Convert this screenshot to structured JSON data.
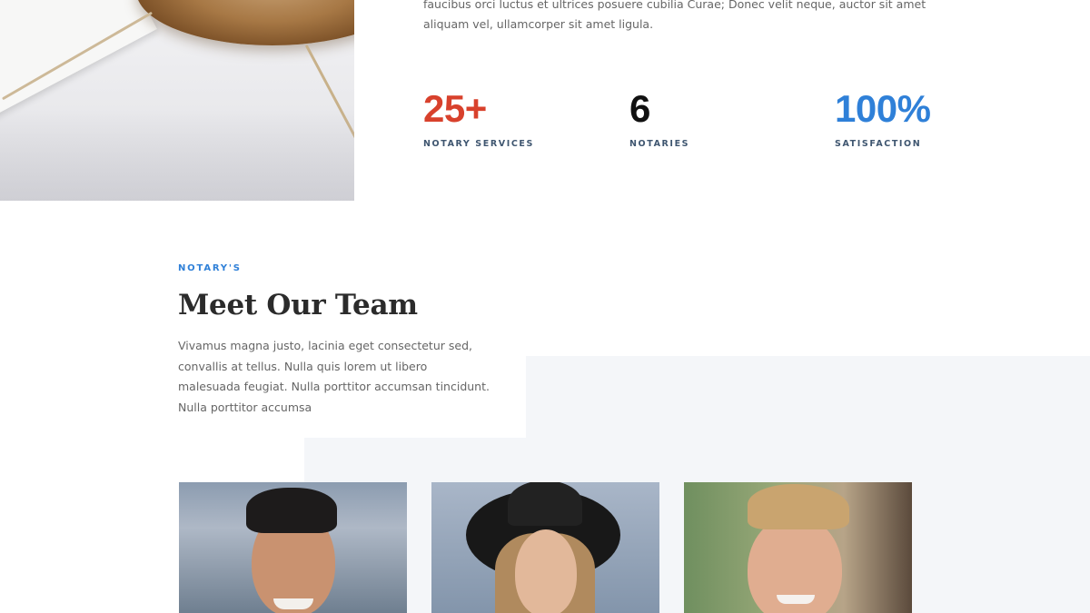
{
  "intro": {
    "text": "faucibus orci luctus et ultrices posuere cubilia Curae; Donec velit neque, auctor sit amet aliquam vel, ullamcorper sit amet ligula."
  },
  "stats": [
    {
      "value": "25+",
      "label": "NOTARY SERVICES",
      "color": "#d8412c"
    },
    {
      "value": "6",
      "label": "NOTARIES",
      "color": "#111111"
    },
    {
      "value": "100%",
      "label": "SATISFACTION",
      "color": "#2f80d8"
    }
  ],
  "team_section": {
    "eyebrow": "NOTARY'S",
    "eyebrow_color": "#2f80d8",
    "title": "Meet Our Team",
    "description": "Vivamus magna justo, lacinia eget consectetur sed, convallis at tellus. Nulla quis lorem ut libero malesuada feugiat. Nulla porttitor accumsan tincidunt. Nulla porttitor accumsa"
  },
  "team_members": [
    {
      "photo": "smiling-man-portrait"
    },
    {
      "photo": "woman-in-black-hat-portrait"
    },
    {
      "photo": "blond-man-portrait"
    }
  ]
}
